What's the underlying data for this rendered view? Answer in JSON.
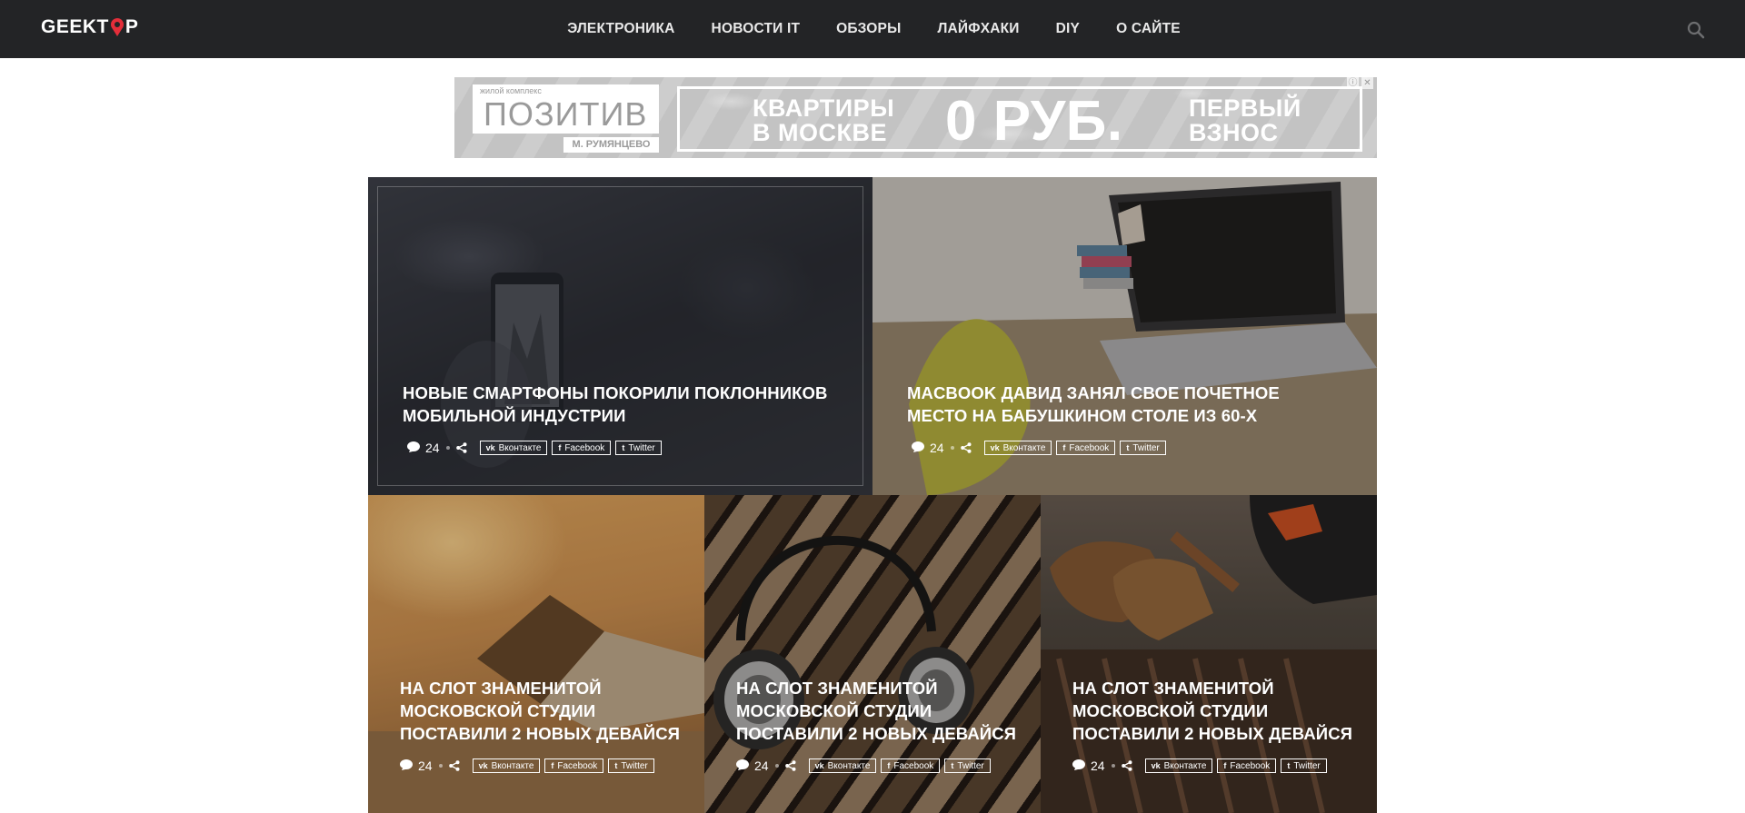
{
  "header": {
    "logo": {
      "text_before": "GEEKT",
      "text_after": "P",
      "accent_color": "#e42e3a"
    },
    "nav": [
      {
        "label": "ЭЛЕКТРОНИКА"
      },
      {
        "label": "НОВОСТИ IT"
      },
      {
        "label": "ОБЗОРЫ"
      },
      {
        "label": "ЛАЙФХАКИ"
      },
      {
        "label": "DIY"
      },
      {
        "label": "О САЙТЕ"
      }
    ],
    "search_icon": "search-icon"
  },
  "ad": {
    "brand_small": "жилой комплекс",
    "brand_name": "ПОЗИТИВ",
    "brand_metro": "М. РУМЯНЦЕВО",
    "offer_left_line1": "КВАРТИРЫ",
    "offer_left_line2": "В МОСКВЕ",
    "offer_big": "0 РУБ.",
    "offer_right_line1": "ПЕРВЫЙ",
    "offer_right_line2": "ВЗНОС",
    "info_icon": "info-icon",
    "close_icon": "close-icon"
  },
  "cards": [
    {
      "title": "НОВЫЕ СМАРТФОНЫ ПОКОРИЛИ ПОКЛОННИКОВ МОБИЛЬНОЙ ИНДУСТРИИ",
      "comments": "24",
      "share": [
        "Вконтакте",
        "Facebook",
        "Twitter"
      ]
    },
    {
      "title": "MACBOOK ДАВИД ЗАНЯЛ СВОЕ ПОЧЕТНОЕ МЕСТО НА БАБУШКИНОМ СТОЛЕ ИЗ 60-Х",
      "comments": "24",
      "share": [
        "Вконтакте",
        "Facebook",
        "Twitter"
      ]
    },
    {
      "title": "НА СЛОТ ЗНАМЕНИТОЙ МОСКОВСКОЙ СТУДИИ ПОСТАВИЛИ 2 НОВЫХ ДЕВАЙСЯ",
      "comments": "24",
      "share": [
        "Вконтакте",
        "Facebook",
        "Twitter"
      ]
    },
    {
      "title": "НА СЛОТ ЗНАМЕНИТОЙ МОСКОВСКОЙ СТУДИИ ПОСТАВИЛИ 2 НОВЫХ ДЕВАЙСЯ",
      "comments": "24",
      "share": [
        "Вконтакте",
        "Facebook",
        "Twitter"
      ]
    },
    {
      "title": "НА СЛОТ ЗНАМЕНИТОЙ МОСКОВСКОЙ СТУДИИ ПОСТАВИЛИ 2 НОВЫХ ДЕВАЙСЯ",
      "comments": "24",
      "share": [
        "Вконтакте",
        "Facebook",
        "Twitter"
      ]
    }
  ]
}
